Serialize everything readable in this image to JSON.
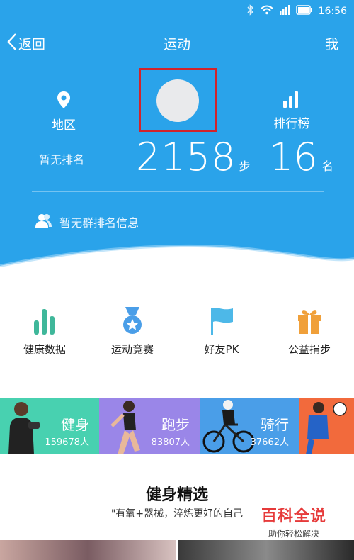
{
  "status": {
    "time": "16:56"
  },
  "nav": {
    "back_label": "返回",
    "title": "运动",
    "me_label": "我"
  },
  "profile": {
    "region_label": "地区",
    "rank_list_label": "排行榜",
    "no_rank_text": "暂无排名",
    "steps_value": "2158",
    "steps_unit": "步",
    "rank_value": "16",
    "rank_unit": "名",
    "group_text": "暂无群排名信息"
  },
  "features": [
    {
      "label": "健康数据",
      "icon": "bar-chart-icon"
    },
    {
      "label": "运动竞赛",
      "icon": "medal-icon"
    },
    {
      "label": "好友PK",
      "icon": "flag-icon"
    },
    {
      "label": "公益捐步",
      "icon": "gift-icon"
    }
  ],
  "tiles": [
    {
      "title": "健身",
      "count": "159678人",
      "color": "#48d1b0"
    },
    {
      "title": "跑步",
      "count": "83807人",
      "color": "#9a86e8"
    },
    {
      "title": "骑行",
      "count": "37662人",
      "color": "#4a9ee8"
    },
    {
      "title": "",
      "count": "",
      "color": "#f26a3c"
    }
  ],
  "section": {
    "title": "健身精选",
    "subtitle": "\"有氧+器械，淬炼更好的自己"
  },
  "watermark": {
    "main": "百科全说",
    "sub": "助你轻松解决"
  },
  "colors": {
    "hero": "#2aa3ea",
    "frame": "#d2232a"
  }
}
